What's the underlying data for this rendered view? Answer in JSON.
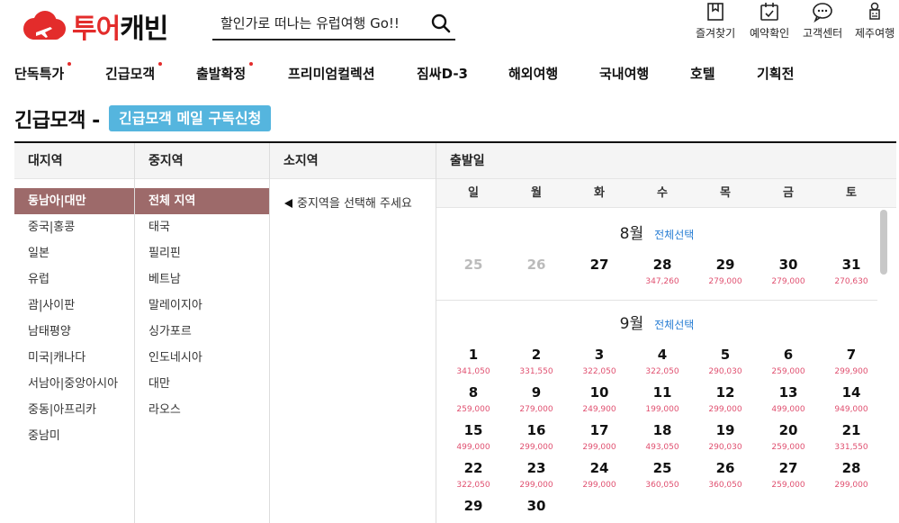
{
  "logo": {
    "part1": "투어",
    "part2": "캐빈"
  },
  "search": {
    "placeholder": "할인가로 떠나는 유럽여행 Go!!"
  },
  "util": [
    "즐겨찾기",
    "예약확인",
    "고객센터",
    "제주여행"
  ],
  "gnb": [
    "단독특가",
    "긴급모객",
    "출발확정",
    "프리미엄컬렉션",
    "짐싸D-3",
    "해외여행",
    "국내여행",
    "호텔",
    "기획전"
  ],
  "page": {
    "title": "긴급모객 -",
    "subscribe": "긴급모객 메일 구독신청"
  },
  "columns": {
    "major": "대지역",
    "middle": "중지역",
    "minor": "소지역",
    "depart": "출발일"
  },
  "major_regions": [
    "동남아|대만",
    "중국|홍콩",
    "일본",
    "유럽",
    "괌|사이판",
    "남태평양",
    "미국|캐나다",
    "서남아|중앙아시아",
    "중동|아프리카",
    "중남미"
  ],
  "middle_regions": [
    "전체 지역",
    "태국",
    "필리핀",
    "베트남",
    "말레이지아",
    "싱가포르",
    "인도네시아",
    "대만",
    "라오스"
  ],
  "minor_hint": "중지역을 선택해 주세요",
  "calendar": {
    "weekdays": [
      "일",
      "월",
      "화",
      "수",
      "목",
      "금",
      "토"
    ],
    "select_all": "전체선택",
    "months": [
      {
        "label": "8월",
        "weeks": [
          [
            {
              "day": "25",
              "price": "",
              "past": true
            },
            {
              "day": "26",
              "price": "",
              "past": true
            },
            {
              "day": "27",
              "price": ""
            },
            {
              "day": "28",
              "price": "347,260"
            },
            {
              "day": "29",
              "price": "279,000"
            },
            {
              "day": "30",
              "price": "279,000"
            },
            {
              "day": "31",
              "price": "270,630"
            }
          ]
        ]
      },
      {
        "label": "9월",
        "weeks": [
          [
            {
              "day": "1",
              "price": "341,050"
            },
            {
              "day": "2",
              "price": "331,550"
            },
            {
              "day": "3",
              "price": "322,050"
            },
            {
              "day": "4",
              "price": "322,050"
            },
            {
              "day": "5",
              "price": "290,030"
            },
            {
              "day": "6",
              "price": "259,000"
            },
            {
              "day": "7",
              "price": "299,900"
            }
          ],
          [
            {
              "day": "8",
              "price": "259,000"
            },
            {
              "day": "9",
              "price": "279,000"
            },
            {
              "day": "10",
              "price": "249,900"
            },
            {
              "day": "11",
              "price": "199,000"
            },
            {
              "day": "12",
              "price": "299,000"
            },
            {
              "day": "13",
              "price": "499,000"
            },
            {
              "day": "14",
              "price": "949,000"
            }
          ],
          [
            {
              "day": "15",
              "price": "499,000"
            },
            {
              "day": "16",
              "price": "299,000"
            },
            {
              "day": "17",
              "price": "299,000"
            },
            {
              "day": "18",
              "price": "493,050"
            },
            {
              "day": "19",
              "price": "290,030"
            },
            {
              "day": "20",
              "price": "259,000"
            },
            {
              "day": "21",
              "price": "331,550"
            }
          ],
          [
            {
              "day": "22",
              "price": "322,050"
            },
            {
              "day": "23",
              "price": "299,000"
            },
            {
              "day": "24",
              "price": "299,000"
            },
            {
              "day": "25",
              "price": "360,050"
            },
            {
              "day": "26",
              "price": "360,050"
            },
            {
              "day": "27",
              "price": "259,000"
            },
            {
              "day": "28",
              "price": "299,000"
            }
          ],
          [
            {
              "day": "29",
              "price": ""
            },
            {
              "day": "30",
              "price": ""
            }
          ]
        ]
      }
    ]
  },
  "colors": {
    "brand": "#e32c2b",
    "accent": "#55b5de",
    "selected": "#9d6a6a",
    "price": "#e05070",
    "link": "#2a7fd4"
  },
  "icons": {
    "util": [
      "bookmark-icon",
      "calendar-check-icon",
      "chat-icon",
      "jeju-icon"
    ],
    "search": "search-icon"
  }
}
